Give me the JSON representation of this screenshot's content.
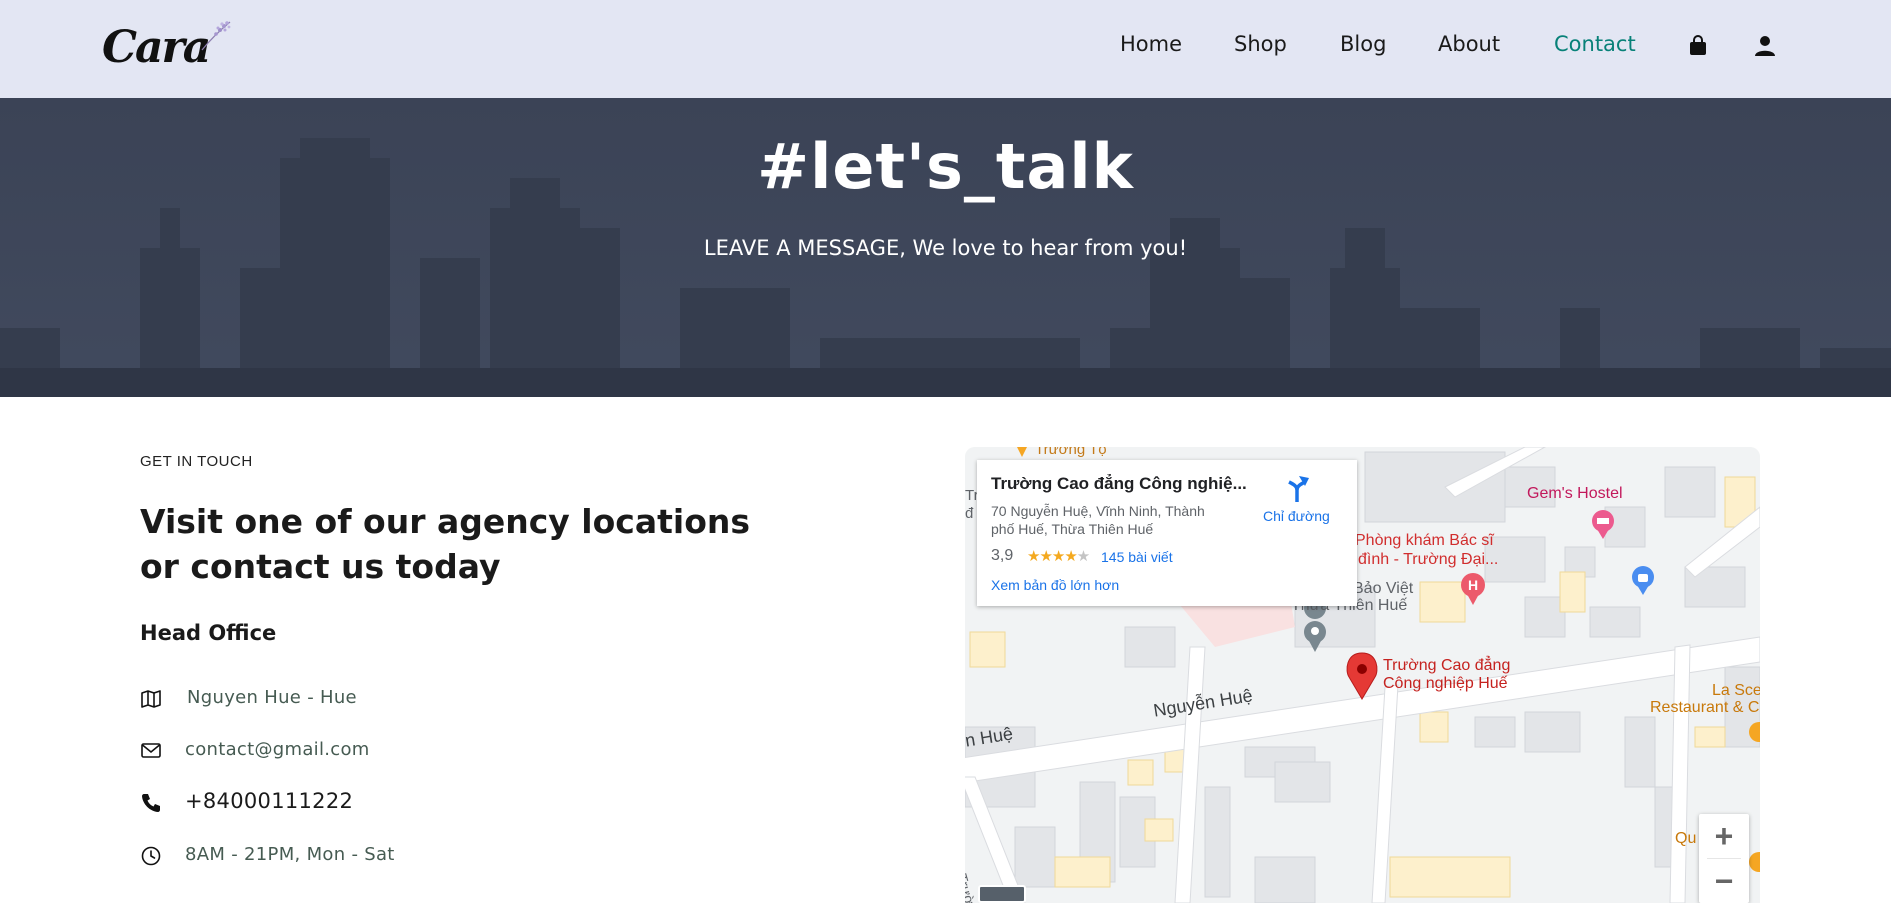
{
  "brand": {
    "logo_text": "Cara"
  },
  "nav": {
    "items": [
      {
        "label": "Home"
      },
      {
        "label": "Shop"
      },
      {
        "label": "Blog"
      },
      {
        "label": "About"
      },
      {
        "label": "Contact"
      }
    ],
    "active_label": "Contact",
    "icons": [
      "shopping-bag-icon",
      "user-icon"
    ]
  },
  "hero": {
    "title": "#let's_talk",
    "subtitle": "LEAVE A MESSAGE, We love to hear from you!"
  },
  "contact": {
    "eyebrow": "GET IN TOUCH",
    "headline": "Visit one of our agency locations or contact us today",
    "office_title": "Head Office",
    "rows": [
      {
        "icon": "map-icon",
        "text": "Nguyen Hue - Hue"
      },
      {
        "icon": "envelope-icon",
        "text": "contact@gmail.com"
      },
      {
        "icon": "phone-icon",
        "text": "+84000111222"
      },
      {
        "icon": "clock-icon",
        "text": "8AM - 21PM, Mon - Sat"
      }
    ]
  },
  "map": {
    "card": {
      "title": "Trường Cao đẳng Công nghiệ...",
      "address": "70 Nguyễn Huệ, Vĩnh Ninh, Thành phố Huế, Thừa Thiên Huế",
      "rating": "3,9",
      "stars": 3.9,
      "reviews": "145 bài viết",
      "larger_map": "Xem bản đồ lớn hơn",
      "directions": "Chỉ đường"
    },
    "labels": {
      "gems_hostel": "Gem's Hostel",
      "clinic_line1": "Phòng khám Bác sĩ",
      "clinic_line2": "đình - Trường Đại...",
      "bao_viet_line1": "Bảo Việt",
      "bao_viet_line2": "Thừa Thiên Huế",
      "college_line1": "Trường Cao đẳng",
      "college_line2": "Công nghiệp Huế",
      "street_main": "Nguyễn Huệ",
      "street_left": "n Huệ",
      "street_vertical": "Nguyễn Trường...",
      "top_label": "Trường Tộ",
      "restaurant_line1": "La Sce",
      "restaurant_line2": "Restaurant & C",
      "bottom_right": "Qu",
      "card_edge_1": "Tr",
      "card_edge_2": "đ"
    },
    "zoom": {
      "in": "+",
      "out": "−"
    },
    "colors": {
      "pin": "#e53935",
      "link": "#1a73e8",
      "road": "#ffffff",
      "block": "#dcdee2"
    }
  },
  "colors": {
    "header_bg": "#e3e6f3",
    "accent": "#088178",
    "hero_bg": "#3d4558"
  }
}
